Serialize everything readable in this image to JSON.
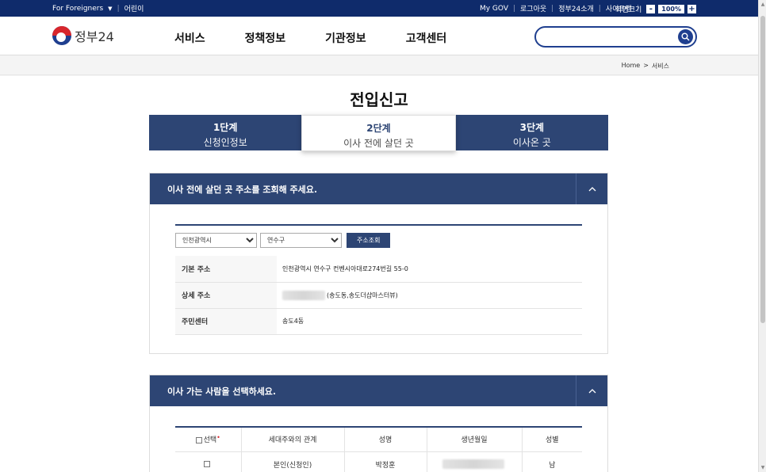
{
  "topbar": {
    "foreigners": "For Foreigners",
    "kids": "어린이",
    "mygov": "My GOV",
    "logout": "로그아웃",
    "intro": "정부24소개",
    "sitemap": "사이트맵",
    "screen_size": "화면크기",
    "zoom_minus": "-",
    "zoom_value": "100%",
    "zoom_plus": "+"
  },
  "header": {
    "logo_text": "정부24",
    "nav": [
      "서비스",
      "정책정보",
      "기관정보",
      "고객센터"
    ],
    "search_placeholder": ""
  },
  "breadcrumb": {
    "home": "Home",
    "sep": ">",
    "current": "서비스"
  },
  "page_title": "전입신고",
  "steps": [
    {
      "num": "1단계",
      "label": "신청인정보"
    },
    {
      "num": "2단계",
      "label": "이사 전에 살던 곳"
    },
    {
      "num": "3단계",
      "label": "이사온 곳"
    }
  ],
  "panel1": {
    "title": "이사 전에 살던 곳 주소를 조회해 주세요.",
    "city": "인천광역시",
    "district": "연수구",
    "lookup_btn": "주소조회",
    "rows": [
      {
        "label": "기본 주소",
        "value": "인천광역시 연수구 컨벤시아대로274번길 55-0"
      },
      {
        "label": "상세 주소",
        "value": "(송도동,송도더샵마스터뷰)"
      },
      {
        "label": "주민센터",
        "value": "송도4동"
      }
    ]
  },
  "panel2": {
    "title": "이사 가는 사람을 선택하세요.",
    "headers": [
      "선택",
      "세대주와의 관계",
      "성명",
      "생년월일",
      "성별"
    ],
    "rows": [
      {
        "relation": "본인(신청인)",
        "name": "박정훈",
        "gender": "남"
      }
    ]
  }
}
